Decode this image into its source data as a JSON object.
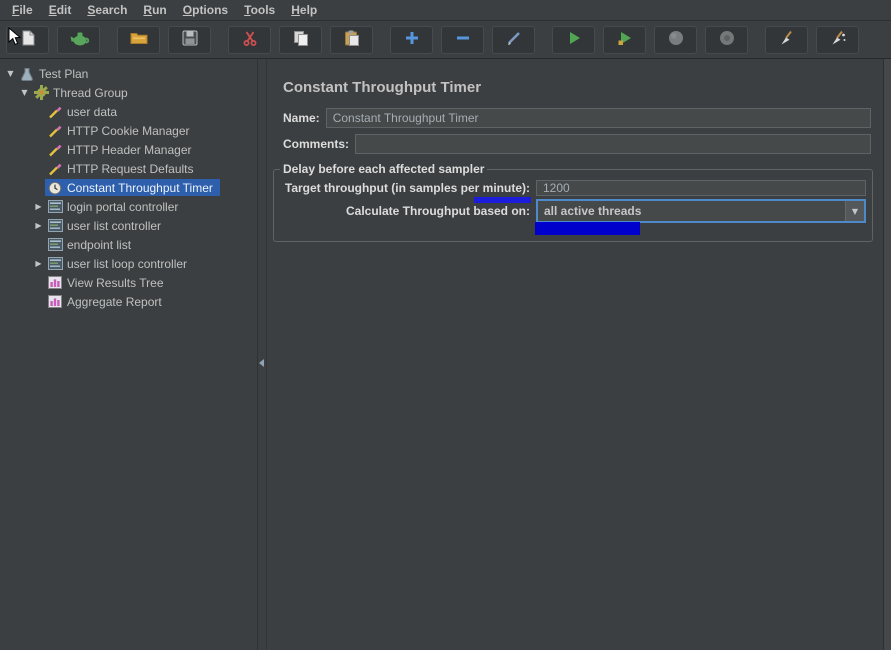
{
  "colors": {
    "selection": "#2e5fac",
    "focus": "#4e8ac9",
    "accent_blue": "#5596dd",
    "annotation_underline": "#1c1cdc",
    "annotation_box": "#0000cd"
  },
  "menubar": {
    "items": [
      "File",
      "Edit",
      "Search",
      "Run",
      "Options",
      "Tools",
      "Help"
    ]
  },
  "toolbar": {
    "groups": [
      [
        "new-file",
        "templates"
      ],
      [
        "open-folder",
        "save"
      ],
      [
        "cut",
        "copy",
        "paste"
      ],
      [
        "plus",
        "minus",
        "toggle"
      ],
      [
        "start",
        "start-no-pauses",
        "stop",
        "shutdown"
      ],
      [
        "clear",
        "clear-all"
      ]
    ],
    "disabled": [
      "stop",
      "shutdown"
    ]
  },
  "tree": {
    "items": [
      {
        "label": "Test Plan",
        "depth": 0,
        "arrow": "expanded",
        "icon": "test-plan-icon",
        "selected": false
      },
      {
        "label": "Thread Group",
        "depth": 1,
        "arrow": "expanded",
        "icon": "thread-group-icon",
        "selected": false
      },
      {
        "label": "user data",
        "depth": 2,
        "arrow": "none",
        "icon": "config-icon",
        "selected": false
      },
      {
        "label": "HTTP Cookie Manager",
        "depth": 2,
        "arrow": "none",
        "icon": "config-icon",
        "selected": false
      },
      {
        "label": "HTTP Header Manager",
        "depth": 2,
        "arrow": "none",
        "icon": "config-icon",
        "selected": false
      },
      {
        "label": "HTTP Request Defaults",
        "depth": 2,
        "arrow": "none",
        "icon": "config-icon",
        "selected": false
      },
      {
        "label": "Constant Throughput Timer",
        "depth": 2,
        "arrow": "none",
        "icon": "timer-icon",
        "selected": true
      },
      {
        "label": "login portal controller",
        "depth": 2,
        "arrow": "collapsed",
        "icon": "controller-icon",
        "selected": false
      },
      {
        "label": "user list controller",
        "depth": 2,
        "arrow": "collapsed",
        "icon": "controller-icon",
        "selected": false
      },
      {
        "label": "endpoint list",
        "depth": 2,
        "arrow": "none",
        "icon": "controller-icon",
        "selected": false
      },
      {
        "label": "user list loop controller",
        "depth": 2,
        "arrow": "collapsed",
        "icon": "controller-icon",
        "selected": false
      },
      {
        "label": "View Results Tree",
        "depth": 2,
        "arrow": "none",
        "icon": "listener-icon",
        "selected": false
      },
      {
        "label": "Aggregate Report",
        "depth": 2,
        "arrow": "none",
        "icon": "listener-icon",
        "selected": false
      }
    ]
  },
  "main": {
    "title": "Constant Throughput Timer",
    "name_label": "Name:",
    "name_value": "Constant Throughput Timer",
    "comments_label": "Comments:",
    "comments_value": "",
    "group_title": "Delay before each affected sampler",
    "throughput_label": "Target throughput (in samples per minute):",
    "throughput_value": "1200",
    "calc_label": "Calculate Throughput based on:",
    "calc_value": "all active threads"
  }
}
